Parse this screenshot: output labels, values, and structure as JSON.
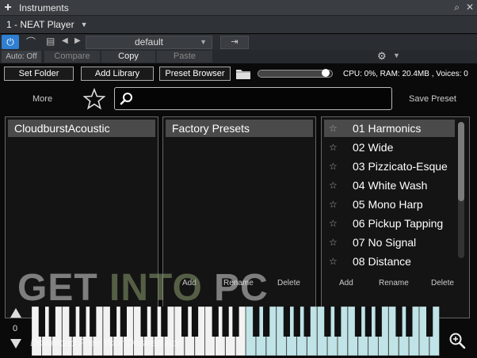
{
  "window": {
    "title": "Instruments"
  },
  "instrument": {
    "name": "1 - NEAT Player"
  },
  "controls": {
    "preset_name": "default"
  },
  "autobar": {
    "auto_off": "Auto: Off",
    "compare": "Compare",
    "copy": "Copy",
    "paste": "Paste"
  },
  "toolbar": {
    "set_folder": "Set Folder",
    "add_library": "Add Library",
    "preset_browser": "Preset Browser",
    "volume_level": 0.92,
    "stats": "CPU: 0%, RAM: 20.4MB , Voices: 0"
  },
  "browser": {
    "more": "More",
    "search_value": "",
    "save_preset": "Save Preset",
    "library_panel": {
      "header": "CloudburstAcoustic"
    },
    "folder_panel": {
      "header": "Factory Presets"
    },
    "preset_panel": {
      "items": [
        {
          "label": "01 Harmonics",
          "selected": true
        },
        {
          "label": "02 Wide",
          "selected": false
        },
        {
          "label": "03 Pizzicato-Esque",
          "selected": false
        },
        {
          "label": "04 White Wash",
          "selected": false
        },
        {
          "label": "05 Mono Harp",
          "selected": false
        },
        {
          "label": "06 Pickup Tapping",
          "selected": false
        },
        {
          "label": "07 No Signal",
          "selected": false
        },
        {
          "label": "08 Distance",
          "selected": false
        }
      ]
    },
    "folder_buttons": {
      "add": "Add",
      "rename": "Rename",
      "delete": "Delete"
    },
    "preset_buttons": {
      "add": "Add",
      "rename": "Rename",
      "delete": "Delete"
    }
  },
  "keyboard": {
    "octave": "0"
  },
  "watermark": {
    "get": "GET ",
    "into": "INTO",
    "pc": " PC",
    "tagline": "Download Free Your Desired App"
  },
  "colors": {
    "accent": "#2f7fd2",
    "panel_header": "#4a4a4a",
    "key_highlight": "#bfe3e6"
  },
  "icons": {
    "add": "plus-icon",
    "pin": "pin-icon",
    "close": "close-icon",
    "power": "power-icon",
    "midi": "midi-icon",
    "preset_doc": "document-icon",
    "expand": "expand-icon",
    "settings": "gear-icon",
    "folder": "folder-icon",
    "favorite": "star-icon",
    "search": "search-icon",
    "zoom": "zoom-in-icon"
  }
}
